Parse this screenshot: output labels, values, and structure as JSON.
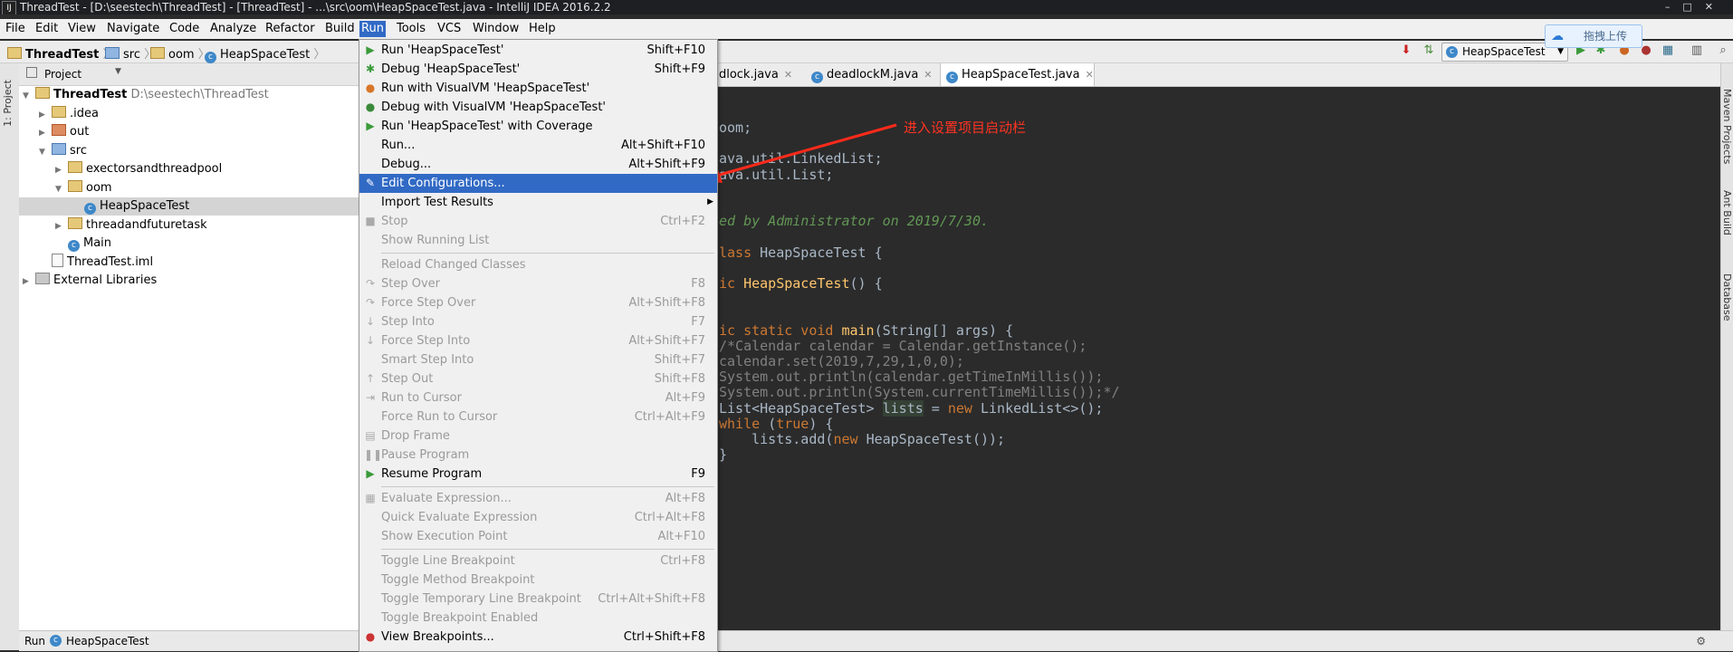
{
  "window": {
    "title": "ThreadTest - [D:\\seestech\\ThreadTest] - [ThreadTest] - ...\\src\\oom\\HeapSpaceTest.java - IntelliJ IDEA 2016.2.2",
    "app_icon": "IJ"
  },
  "menubar": {
    "items": [
      "File",
      "Edit",
      "View",
      "Navigate",
      "Code",
      "Analyze",
      "Refactor",
      "Build",
      "Run",
      "Tools",
      "VCS",
      "Window",
      "Help"
    ],
    "active": "Run"
  },
  "breadcrumb": [
    "ThreadTest",
    "src",
    "oom",
    "HeapSpaceTest"
  ],
  "toolbar": {
    "run_config": "HeapSpaceTest",
    "upload_label": "拖拽上传",
    "icons": [
      "build-icon",
      "run-icon",
      "debug-icon",
      "coverage-icon",
      "stop-icon",
      "layout-icon",
      "project-structure-icon",
      "search-icon"
    ]
  },
  "left_strip": {
    "project_tab": "1: Project"
  },
  "project_panel": {
    "dropdown_label": "Project",
    "tree": [
      {
        "label": "ThreadTest",
        "hint": "D:\\seestech\\ThreadTest",
        "icon": "folder",
        "indent": 0,
        "arrow": "down",
        "bold": true
      },
      {
        "label": ".idea",
        "icon": "folder",
        "indent": 1,
        "arrow": "right"
      },
      {
        "label": "out",
        "icon": "folder-red",
        "indent": 1,
        "arrow": "right"
      },
      {
        "label": "src",
        "icon": "folder-blue",
        "indent": 1,
        "arrow": "down"
      },
      {
        "label": "exectorsandthreadpool",
        "icon": "folder",
        "indent": 2,
        "arrow": "right"
      },
      {
        "label": "oom",
        "icon": "folder",
        "indent": 2,
        "arrow": "down"
      },
      {
        "label": "HeapSpaceTest",
        "icon": "class",
        "indent": 3,
        "arrow": "",
        "selected": true
      },
      {
        "label": "threadandfuturetask",
        "icon": "folder",
        "indent": 2,
        "arrow": "right"
      },
      {
        "label": "Main",
        "icon": "class",
        "indent": 2,
        "arrow": ""
      },
      {
        "label": "ThreadTest.iml",
        "icon": "file",
        "indent": 1,
        "arrow": ""
      },
      {
        "label": "External Libraries",
        "icon": "library",
        "indent": 0,
        "arrow": "right"
      }
    ]
  },
  "bottom_bar": {
    "run_label": "Run",
    "config": "HeapSpaceTest"
  },
  "editor_tabs": [
    {
      "label": "adlock.java",
      "active": false
    },
    {
      "label": "deadlockM.java",
      "active": false
    },
    {
      "label": "HeapSpaceTest.java",
      "active": true
    }
  ],
  "code_lines": [
    {
      "segs": [
        {
          "t": "oom;",
          "c": ""
        }
      ]
    },
    {
      "segs": []
    },
    {
      "segs": [
        {
          "t": "ava.util.LinkedList;",
          "c": ""
        }
      ]
    },
    {
      "segs": [
        {
          "t": "ava.util.List;",
          "c": ""
        }
      ]
    },
    {
      "segs": []
    },
    {
      "segs": []
    },
    {
      "segs": [
        {
          "t": "ed by Administrator on 2019/7/30.",
          "c": "doc"
        }
      ]
    },
    {
      "segs": []
    },
    {
      "segs": [
        {
          "t": "lass ",
          "c": "kw"
        },
        {
          "t": "HeapSpaceTest {",
          "c": ""
        }
      ]
    },
    {
      "segs": []
    },
    {
      "segs": [
        {
          "t": "ic ",
          "c": "kw"
        },
        {
          "t": "HeapSpaceTest",
          "c": "fn"
        },
        {
          "t": "() {",
          "c": ""
        }
      ]
    },
    {
      "segs": []
    },
    {
      "segs": []
    },
    {
      "segs": [
        {
          "t": "ic static void ",
          "c": "kw"
        },
        {
          "t": "main",
          "c": "fn"
        },
        {
          "t": "(String[] args) {",
          "c": ""
        }
      ]
    },
    {
      "segs": [
        {
          "t": "/*Calendar calendar = Calendar.getInstance();",
          "c": "cm"
        }
      ]
    },
    {
      "segs": [
        {
          "t": "calendar.set(2019,7,29,1,0,0);",
          "c": "cm"
        }
      ]
    },
    {
      "segs": [
        {
          "t": "System.out.println(calendar.getTimeInMillis());",
          "c": "cm"
        }
      ]
    },
    {
      "segs": [
        {
          "t": "System.out.println(System.currentTimeMillis());*/",
          "c": "cm"
        }
      ]
    },
    {
      "segs": [
        {
          "t": "List<HeapSpaceTest> ",
          "c": ""
        },
        {
          "t": "lists",
          "c": "hl"
        },
        {
          "t": " = ",
          "c": ""
        },
        {
          "t": "new ",
          "c": "kw"
        },
        {
          "t": "LinkedList<>();",
          "c": ""
        }
      ]
    },
    {
      "segs": [
        {
          "t": "while ",
          "c": "kw"
        },
        {
          "t": "(",
          "c": ""
        },
        {
          "t": "true",
          "c": "kw"
        },
        {
          "t": ") {",
          "c": ""
        }
      ]
    },
    {
      "segs": [
        {
          "t": "    lists.add(",
          "c": ""
        },
        {
          "t": "new ",
          "c": "kw"
        },
        {
          "t": "HeapSpaceTest());",
          "c": ""
        }
      ]
    },
    {
      "segs": [
        {
          "t": "}",
          "c": ""
        }
      ]
    }
  ],
  "annotation": "进入设置项目启动栏",
  "right_strip": {
    "tabs": [
      "Maven Projects",
      "Ant Build",
      "Database"
    ]
  },
  "run_menu": {
    "items": [
      {
        "label": "Run 'HeapSpaceTest'",
        "shortcut": "Shift+F10",
        "icon": "run-icon",
        "disabled": false
      },
      {
        "label": "Debug 'HeapSpaceTest'",
        "shortcut": "Shift+F9",
        "icon": "debug-icon",
        "disabled": false
      },
      {
        "label": "Run with VisualVM 'HeapSpaceTest'",
        "shortcut": "",
        "icon": "visualvm-run-icon",
        "disabled": false
      },
      {
        "label": "Debug with VisualVM 'HeapSpaceTest'",
        "shortcut": "",
        "icon": "visualvm-debug-icon",
        "disabled": false
      },
      {
        "label": "Run 'HeapSpaceTest' with Coverage",
        "shortcut": "",
        "icon": "coverage-icon",
        "disabled": false
      },
      {
        "label": "Run...",
        "shortcut": "Alt+Shift+F10",
        "icon": "",
        "disabled": false
      },
      {
        "label": "Debug...",
        "shortcut": "Alt+Shift+F9",
        "icon": "",
        "disabled": false
      },
      {
        "label": "Edit Configurations...",
        "shortcut": "",
        "icon": "edit-config-icon",
        "disabled": false,
        "highlighted": true
      },
      {
        "label": "Import Test Results",
        "shortcut": "",
        "icon": "",
        "disabled": false,
        "submenu": true
      },
      {
        "label": "Stop",
        "shortcut": "Ctrl+F2",
        "icon": "stop-icon",
        "disabled": true
      },
      {
        "label": "Show Running List",
        "shortcut": "",
        "icon": "",
        "disabled": true
      },
      {
        "sep": true
      },
      {
        "label": "Reload Changed Classes",
        "shortcut": "",
        "icon": "",
        "disabled": true
      },
      {
        "label": "Step Over",
        "shortcut": "F8",
        "icon": "step-over-icon",
        "disabled": true
      },
      {
        "label": "Force Step Over",
        "shortcut": "Alt+Shift+F8",
        "icon": "force-step-over-icon",
        "disabled": true
      },
      {
        "label": "Step Into",
        "shortcut": "F7",
        "icon": "step-into-icon",
        "disabled": true
      },
      {
        "label": "Force Step Into",
        "shortcut": "Alt+Shift+F7",
        "icon": "force-step-into-icon",
        "disabled": true
      },
      {
        "label": "Smart Step Into",
        "shortcut": "Shift+F7",
        "icon": "",
        "disabled": true
      },
      {
        "label": "Step Out",
        "shortcut": "Shift+F8",
        "icon": "step-out-icon",
        "disabled": true
      },
      {
        "label": "Run to Cursor",
        "shortcut": "Alt+F9",
        "icon": "run-to-cursor-icon",
        "disabled": true
      },
      {
        "label": "Force Run to Cursor",
        "shortcut": "Ctrl+Alt+F9",
        "icon": "",
        "disabled": true
      },
      {
        "label": "Drop Frame",
        "shortcut": "",
        "icon": "drop-frame-icon",
        "disabled": true
      },
      {
        "label": "Pause Program",
        "shortcut": "",
        "icon": "pause-icon",
        "disabled": true
      },
      {
        "label": "Resume Program",
        "shortcut": "F9",
        "icon": "resume-icon",
        "disabled": false
      },
      {
        "sep": true
      },
      {
        "label": "Evaluate Expression...",
        "shortcut": "Alt+F8",
        "icon": "evaluate-icon",
        "disabled": true
      },
      {
        "label": "Quick Evaluate Expression",
        "shortcut": "Ctrl+Alt+F8",
        "icon": "",
        "disabled": true
      },
      {
        "label": "Show Execution Point",
        "shortcut": "Alt+F10",
        "icon": "",
        "disabled": true
      },
      {
        "sep": true
      },
      {
        "label": "Toggle Line Breakpoint",
        "shortcut": "Ctrl+F8",
        "icon": "",
        "disabled": true
      },
      {
        "label": "Toggle Method Breakpoint",
        "shortcut": "",
        "icon": "",
        "disabled": true
      },
      {
        "label": "Toggle Temporary Line Breakpoint",
        "shortcut": "Ctrl+Alt+Shift+F8",
        "icon": "",
        "disabled": true
      },
      {
        "label": "Toggle Breakpoint Enabled",
        "shortcut": "",
        "icon": "",
        "disabled": true
      },
      {
        "label": "View Breakpoints...",
        "shortcut": "Ctrl+Shift+F8",
        "icon": "view-breakpoints-icon",
        "disabled": false
      }
    ]
  },
  "colors": {
    "menu_highlight": "#316ac5",
    "annotation": "#ff3322",
    "editor_bg": "#2b2b2b"
  }
}
